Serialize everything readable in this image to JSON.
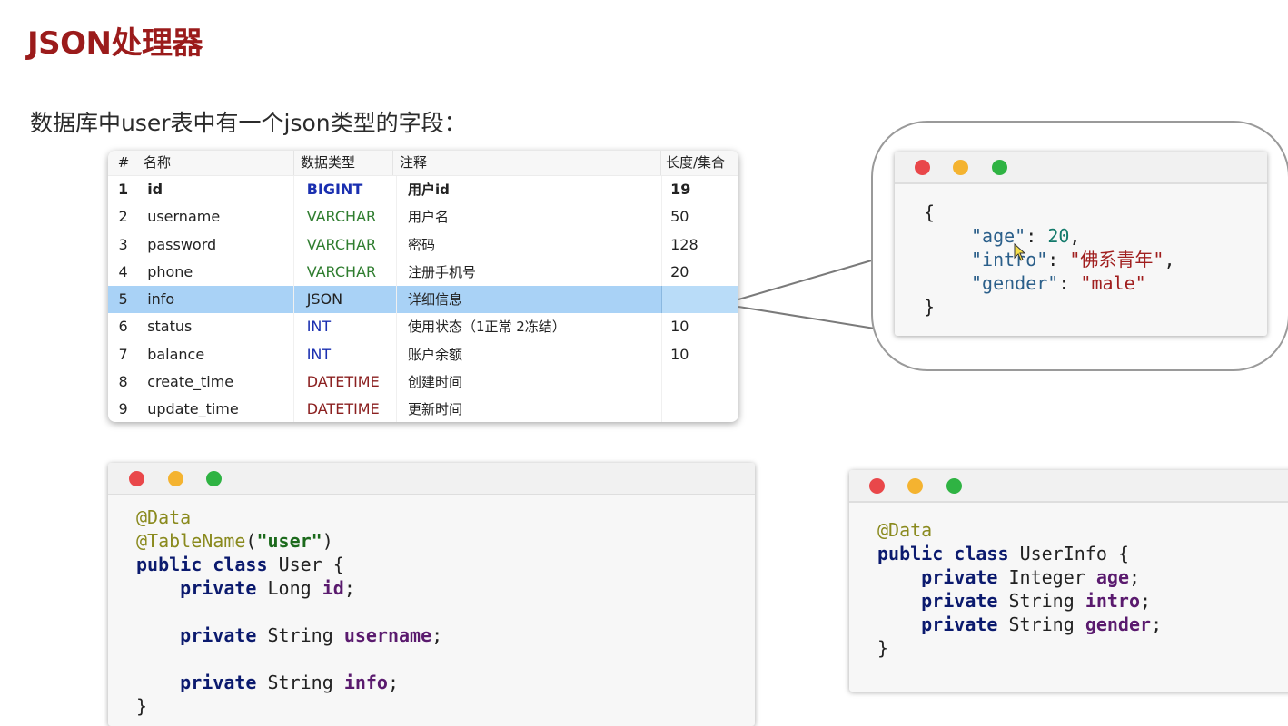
{
  "page": {
    "title": "JSON处理器",
    "subtitle": "数据库中user表中有一个json类型的字段："
  },
  "db_table": {
    "headers": [
      "#",
      "名称",
      "数据类型",
      "注释",
      "长度/集合"
    ],
    "rows": [
      {
        "num": "1",
        "name": "id",
        "type": "BIGINT",
        "comment": "用户id",
        "length": "19",
        "bold": true,
        "type_color": "#1a2fb0"
      },
      {
        "num": "2",
        "name": "username",
        "type": "VARCHAR",
        "comment": "用户名",
        "length": "50",
        "type_color": "#2f7d2f"
      },
      {
        "num": "3",
        "name": "password",
        "type": "VARCHAR",
        "comment": "密码",
        "length": "128",
        "type_color": "#2f7d2f"
      },
      {
        "num": "4",
        "name": "phone",
        "type": "VARCHAR",
        "comment": "注册手机号",
        "length": "20",
        "type_color": "#2f7d2f"
      },
      {
        "num": "5",
        "name": "info",
        "type": "JSON",
        "comment": "详细信息",
        "length": "",
        "selected": true,
        "type_color": "#222222"
      },
      {
        "num": "6",
        "name": "status",
        "type": "INT",
        "comment": "使用状态（1正常 2冻结）",
        "length": "10",
        "type_color": "#1a2fb0"
      },
      {
        "num": "7",
        "name": "balance",
        "type": "INT",
        "comment": "账户余额",
        "length": "10",
        "type_color": "#1a2fb0"
      },
      {
        "num": "8",
        "name": "create_time",
        "type": "DATETIME",
        "comment": "创建时间",
        "length": "",
        "type_color": "#8b2020"
      },
      {
        "num": "9",
        "name": "update_time",
        "type": "DATETIME",
        "comment": "更新时间",
        "length": "",
        "type_color": "#8b2020"
      }
    ],
    "selected_row_color": "#a9d2f6"
  },
  "json_window": {
    "open_brace": "{",
    "close_brace": "}",
    "entries": [
      {
        "key": "\"age\"",
        "sep": ": ",
        "value": "20",
        "tail": ",",
        "kind": "number"
      },
      {
        "key": "\"intro\"",
        "sep": ": ",
        "value": "\"佛系青年\"",
        "tail": ",",
        "kind": "string"
      },
      {
        "key": "\"gender\"",
        "sep": ": ",
        "value": "\"male\"",
        "tail": "",
        "kind": "string"
      }
    ]
  },
  "user_class_window": {
    "annotation_data": "@Data",
    "annotation_table": "@TableName",
    "table_name_open": "(",
    "table_name_value": "\"user\"",
    "table_name_close": ")",
    "kw_public": "public",
    "kw_class": "class",
    "class_name": "User {",
    "kw_private": "private",
    "fields": [
      {
        "type": "Long",
        "name": "id",
        "end": ";"
      },
      {
        "type": "String",
        "name": "username",
        "end": ";"
      },
      {
        "type": "String",
        "name": "info",
        "end": ";"
      }
    ],
    "close_brace": "}"
  },
  "userinfo_class_window": {
    "annotation_data": "@Data",
    "kw_public": "public",
    "kw_class": "class",
    "class_name": "UserInfo {",
    "kw_private": "private",
    "fields": [
      {
        "type": "Integer",
        "name": "age",
        "end": ";"
      },
      {
        "type": "String",
        "name": "intro",
        "end": ";"
      },
      {
        "type": "String",
        "name": "gender",
        "end": ";"
      }
    ],
    "close_brace": "}"
  },
  "colors": {
    "title": "#9b1b1b",
    "window_dot_red": "#e9474a",
    "window_dot_yellow": "#f4b330",
    "window_dot_green": "#2fb343"
  },
  "icons": {
    "window_controls": [
      "close-dot",
      "minimize-dot",
      "maximize-dot"
    ],
    "pointer": "mouse-cursor-icon"
  }
}
